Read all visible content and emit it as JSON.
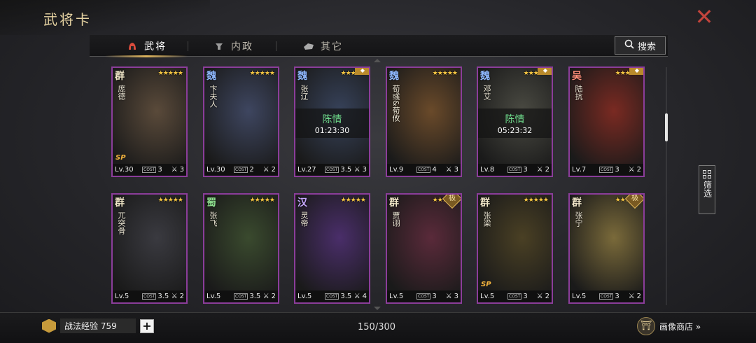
{
  "title": "武将卡",
  "tabs": [
    {
      "label": "武将",
      "icon": "helmet-icon"
    },
    {
      "label": "内政",
      "icon": "lamp-icon"
    },
    {
      "label": "其它",
      "icon": "stone-icon"
    }
  ],
  "search_label": "搜索",
  "filter_label": "筛选",
  "cards": [
    {
      "faction": "群",
      "name": "庞德",
      "stars": "★★★★★",
      "level": "Lv.30",
      "cost": "3",
      "class_num": "3",
      "bg": "#5a4a3a",
      "sp": "SP"
    },
    {
      "faction": "魏",
      "name": "卞夫人",
      "stars": "★★★★★",
      "level": "Lv.30",
      "cost": "2",
      "class_num": "2",
      "bg": "#3e4660"
    },
    {
      "faction": "魏",
      "name": "张辽",
      "stars": "★★★★★",
      "level": "Lv.27",
      "cost": "3.5",
      "class_num": "3",
      "bg": "#37425a",
      "ribbon": true,
      "timer_name": "陈情",
      "timer_time": "01:23:30"
    },
    {
      "faction": "魏",
      "name": "荀彧&荀攸",
      "stars": "★★★★★",
      "level": "Lv.9",
      "cost": "4",
      "class_num": "3",
      "bg": "#6a4a2a"
    },
    {
      "faction": "魏",
      "name": "邓艾",
      "stars": "★★★★★",
      "level": "Lv.8",
      "cost": "3",
      "class_num": "2",
      "bg": "#4a4a42",
      "ribbon": true,
      "timer_name": "陈情",
      "timer_time": "05:23:32"
    },
    {
      "faction": "吴",
      "name": "陆抗",
      "stars": "★★★★★",
      "level": "Lv.7",
      "cost": "3",
      "class_num": "2",
      "bg": "#7a2a22",
      "ribbon": true
    },
    {
      "faction": "群",
      "name": "兀突骨",
      "stars": "★★★★★",
      "level": "Lv.5",
      "cost": "3.5",
      "class_num": "2",
      "bg": "#3a3a40"
    },
    {
      "faction": "蜀",
      "name": "张飞",
      "stars": "★★★★★",
      "level": "Lv.5",
      "cost": "3.5",
      "class_num": "2",
      "bg": "#3a4a2e"
    },
    {
      "faction": "汉",
      "name": "灵帝",
      "stars": "★★★★★",
      "level": "Lv.5",
      "cost": "3.5",
      "class_num": "4",
      "bg": "#4a2e6a"
    },
    {
      "faction": "群",
      "name": "贾诩",
      "stars": "★★★★★",
      "level": "Lv.5",
      "cost": "3",
      "class_num": "3",
      "bg": "#5a2a3a",
      "ji": "极"
    },
    {
      "faction": "群",
      "name": "张梁",
      "stars": "★★★★★",
      "level": "Lv.5",
      "cost": "3",
      "class_num": "2",
      "bg": "#4a4024",
      "sp": "SP"
    },
    {
      "faction": "群",
      "name": "张宁",
      "stars": "★★★★★",
      "level": "Lv.5",
      "cost": "3",
      "class_num": "2",
      "bg": "#7a6a3a",
      "ji": "极"
    }
  ],
  "footer": {
    "exp_label": "战法经验 759",
    "plus_label": "+",
    "count": "150/300",
    "shop_label": "画像商店 »"
  },
  "colors": {
    "accent_gold": "#dbb25c",
    "card_border": "#8b3d9a",
    "timer_green": "#6fdc8c",
    "close_red": "#c2443c"
  }
}
